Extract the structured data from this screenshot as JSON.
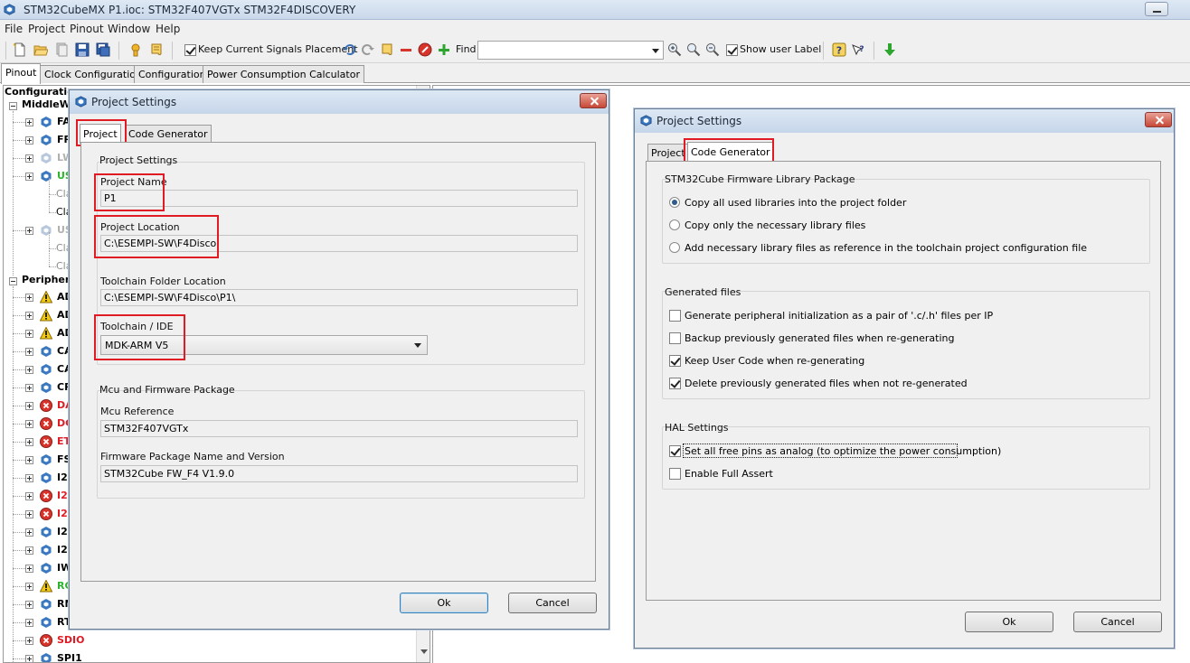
{
  "window": {
    "title": "STM32CubeMX P1.ioc: STM32F407VGTx STM32F4DISCOVERY"
  },
  "menu": [
    "File",
    "Project",
    "Pinout",
    "Window",
    "Help"
  ],
  "toolbar": {
    "keep_signals_label": "Keep Current Signals Placement",
    "keep_signals_checked": true,
    "find_label": "Find",
    "find_value": "",
    "show_user_label": "Show user Label",
    "show_user_checked": true
  },
  "main_tabs": [
    "Pinout",
    "Clock Configuration",
    "Configuration",
    "Power Consumption Calculator"
  ],
  "tree": {
    "root": "Configuration",
    "middleware": "MiddleWa",
    "middleware_items": [
      {
        "text": "FA",
        "status": "ok",
        "color": "#000000"
      },
      {
        "text": "FR",
        "status": "ok",
        "color": "#000000"
      },
      {
        "text": "LW",
        "status": "disabled",
        "color": "#b0b0b0"
      },
      {
        "text": "US",
        "status": "ok",
        "color": "#2db32d"
      },
      {
        "text": "Cla",
        "status": "sub",
        "color": "#8c8c8c"
      },
      {
        "text": "Cla",
        "status": "sub",
        "color": "#000000"
      },
      {
        "text": "US",
        "status": "disabled",
        "color": "#b0b0b0"
      },
      {
        "text": "Cla",
        "status": "sub",
        "color": "#8c8c8c"
      },
      {
        "text": "Cla",
        "status": "sub",
        "color": "#8c8c8c"
      }
    ],
    "peripherals": "Periphera",
    "peripheral_items": [
      {
        "text": "AD",
        "status": "warn",
        "color": "#000000"
      },
      {
        "text": "AD",
        "status": "warn",
        "color": "#000000"
      },
      {
        "text": "AD",
        "status": "warn",
        "color": "#000000"
      },
      {
        "text": "CA",
        "status": "ok",
        "color": "#000000"
      },
      {
        "text": "CA",
        "status": "ok",
        "color": "#000000"
      },
      {
        "text": "CR",
        "status": "ok",
        "color": "#000000"
      },
      {
        "text": "DA",
        "status": "error",
        "color": "#e01b24"
      },
      {
        "text": "DC",
        "status": "error",
        "color": "#e01b24"
      },
      {
        "text": "ET",
        "status": "error",
        "color": "#e01b24"
      },
      {
        "text": "FS",
        "status": "ok",
        "color": "#000000"
      },
      {
        "text": "I2",
        "status": "ok",
        "color": "#000000"
      },
      {
        "text": "I2",
        "status": "error",
        "color": "#e01b24"
      },
      {
        "text": "I2",
        "status": "error",
        "color": "#e01b24"
      },
      {
        "text": "I2",
        "status": "ok",
        "color": "#000000"
      },
      {
        "text": "I2",
        "status": "ok",
        "color": "#000000"
      },
      {
        "text": "IW",
        "status": "ok",
        "color": "#000000"
      },
      {
        "text": "RC",
        "status": "warn",
        "color": "#2db32d"
      },
      {
        "text": "RN",
        "status": "ok",
        "color": "#000000"
      },
      {
        "text": "RT",
        "status": "ok",
        "color": "#000000"
      },
      {
        "text": "SDIO",
        "status": "error",
        "color": "#e01b24"
      },
      {
        "text": "SPI1",
        "status": "ok",
        "color": "#000000"
      }
    ]
  },
  "dialog1": {
    "title": "Project Settings",
    "tabs": [
      "Project",
      "Code Generator"
    ],
    "group_project": "Project Settings",
    "project_name_label": "Project Name",
    "project_name_value": "P1",
    "project_location_label": "Project Location",
    "project_location_value": "C:\\ESEMPI-SW\\F4Disco",
    "toolchain_folder_label": "Toolchain Folder Location",
    "toolchain_folder_value": "C:\\ESEMPI-SW\\F4Disco\\P1\\",
    "toolchain_ide_label": "Toolchain / IDE",
    "toolchain_ide_value": "MDK-ARM V5",
    "group_mcu": "Mcu and Firmware Package",
    "mcu_ref_label": "Mcu Reference",
    "mcu_ref_value": "STM32F407VGTx",
    "fw_label": "Firmware Package Name and Version",
    "fw_value": "STM32Cube FW_F4 V1.9.0",
    "ok": "Ok",
    "cancel": "Cancel"
  },
  "dialog2": {
    "title": "Project Settings",
    "tabs": [
      "Project",
      "Code Generator"
    ],
    "group_lib": "STM32Cube Firmware Library Package",
    "lib_options": [
      {
        "label": "Copy all used libraries into the project folder",
        "selected": true
      },
      {
        "label": "Copy only the necessary library files",
        "selected": false
      },
      {
        "label": "Add necessary library files as reference in the toolchain project configuration file",
        "selected": false
      }
    ],
    "group_generated": "Generated files",
    "generated_options": [
      {
        "label": "Generate peripheral initialization as a pair of '.c/.h' files per IP",
        "checked": false
      },
      {
        "label": "Backup previously generated files when re-generating",
        "checked": false
      },
      {
        "label": "Keep User Code when re-generating",
        "checked": true
      },
      {
        "label": "Delete previously generated files when not re-generated",
        "checked": true
      }
    ],
    "group_hal": "HAL Settings",
    "hal_options": [
      {
        "label": "Set all free pins as analog (to optimize the power consumption)",
        "checked": true
      },
      {
        "label": "Enable Full Assert",
        "checked": false
      }
    ],
    "ok": "Ok",
    "cancel": "Cancel"
  },
  "colors": {
    "highlight_red": "#e01b24",
    "icon_blue": "#3a78c2",
    "warn_yellow": "#f2c81b",
    "error_red": "#d9342b"
  }
}
